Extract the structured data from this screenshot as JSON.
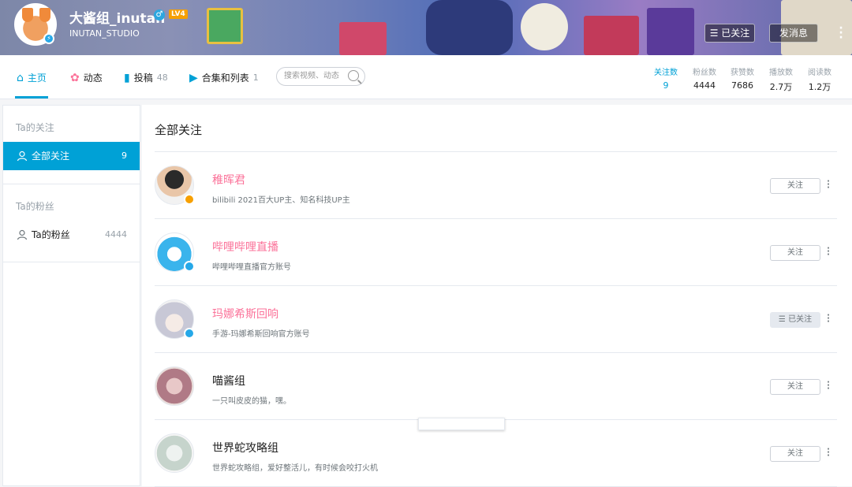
{
  "profile": {
    "username": "大酱组_inutan",
    "level": "LV4",
    "signature": "INUTAN_STUDIO",
    "sex_symbol": "♂",
    "followed_label": "☰ 已关注",
    "message_label": "发消息"
  },
  "nav": {
    "home": "主页",
    "dynamic": "动态",
    "posts": "投稿",
    "posts_count": "48",
    "collections": "合集和列表",
    "collections_count": "1",
    "search_placeholder": "搜索视频、动态"
  },
  "stats": [
    {
      "label": "关注数",
      "value": "9"
    },
    {
      "label": "粉丝数",
      "value": "4444"
    },
    {
      "label": "获赞数",
      "value": "7686"
    },
    {
      "label": "播放数",
      "value": "2.7万"
    },
    {
      "label": "阅读数",
      "value": "1.2万"
    }
  ],
  "sidebar": {
    "following_head": "Ta的关注",
    "all_following": "全部关注",
    "all_following_count": "9",
    "fans_head": "Ta的粉丝",
    "fans_item": "Ta的粉丝",
    "fans_count": "4444"
  },
  "main": {
    "title": "全部关注",
    "rows": [
      {
        "name": "稚晖君",
        "desc": "bilibili 2021百大UP主、知名科技UP主",
        "button": "关注"
      },
      {
        "name": "哔哩哔哩直播",
        "desc": "哔哩哔哩直播官方账号",
        "button": "关注"
      },
      {
        "name": "玛娜希斯回响",
        "desc": "手游-玛娜希斯回响官方账号",
        "button": "☰ 已关注"
      },
      {
        "name": "喵酱组",
        "desc": "一只叫皮皮的猫，嘿。",
        "button": "关注"
      },
      {
        "name": "世界蛇攻略组",
        "desc": "世界蛇攻略组，爱好整活儿，有时候会咬打火机",
        "button": "关注"
      }
    ]
  },
  "colors": {
    "accent": "#00a1d6",
    "pink": "#fb7299"
  }
}
